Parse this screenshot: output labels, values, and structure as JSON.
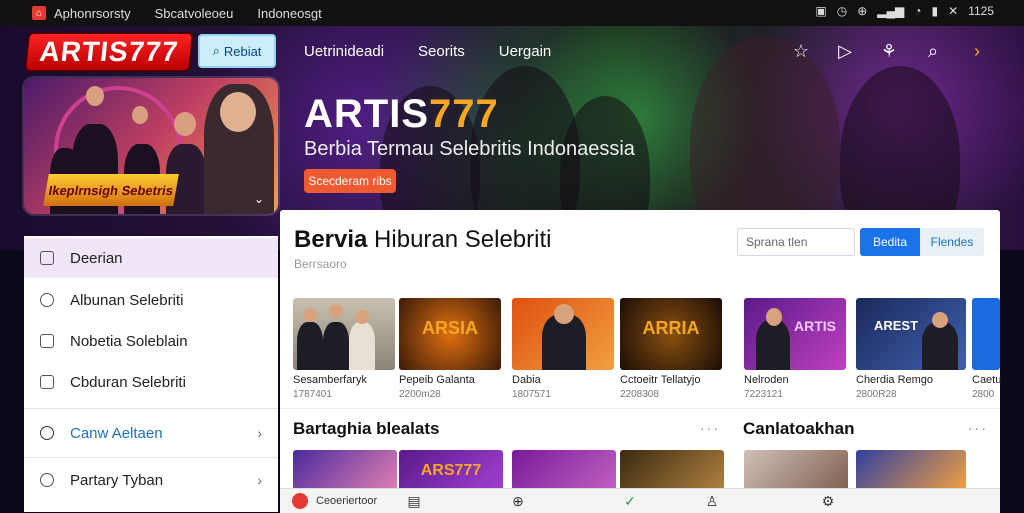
{
  "status_bar": {
    "items": [
      "Aphonrsorsty",
      "Sbcatvoleoeu",
      "Indoneosgt"
    ],
    "time": "1125"
  },
  "header": {
    "logo": "ARTIS777",
    "search_label": "Rebiat",
    "nav": [
      "Uetrinideadi",
      "Seorits",
      "Uergain"
    ]
  },
  "hero": {
    "badge": "Ikeplrnsigh Sebetris",
    "title_a": "ARTIS",
    "title_b": "777",
    "subtitle": "Berbia Termau Selebritis Indonaessia",
    "cta": "Scecderam ribs"
  },
  "sidebar": {
    "items": [
      {
        "label": "Deerian",
        "icon": "home-icon"
      },
      {
        "label": "Albunan Selebriti",
        "icon": "heart-icon"
      },
      {
        "label": "Nobetia Soleblain",
        "icon": "house-icon"
      },
      {
        "label": "Cbduran Selebriti",
        "icon": "square-icon"
      },
      {
        "label": "Canw Aeltaen",
        "icon": "heart-icon"
      },
      {
        "label": "Partary Tyban",
        "icon": "smile-icon"
      }
    ]
  },
  "main": {
    "title_bold": "Bervia",
    "title_rest": " Hiburan Selebriti",
    "subtitle": "Berrsaoro",
    "filter_placeholder": "Sprana tlen",
    "filter_btn_a": "Bedita",
    "filter_btn_b": "Flendes",
    "cards": [
      {
        "title": "Sesamberfaryk",
        "meta": "1787401",
        "thumb_text": ""
      },
      {
        "title": "Pepeib Galanta",
        "meta": "2200m28",
        "thumb_text": "ARSIA"
      },
      {
        "title": "Dabia",
        "meta": "1807571",
        "thumb_text": ""
      },
      {
        "title": "Cctoeitr Tellatyjo",
        "meta": "2208308",
        "thumb_text": "ARRIA"
      },
      {
        "title": "Nelroden",
        "meta": "7223121",
        "thumb_text": "ARTIS"
      },
      {
        "title": "Cherdia Remgo",
        "meta": "2800R28",
        "thumb_text": "AREST"
      },
      {
        "title": "Caetu",
        "meta": "2800",
        "thumb_text": ""
      }
    ],
    "section_left": "Bartaghia blealats",
    "section_right": "Canlatoakhan",
    "more": "···",
    "row2_texts": [
      "",
      "ARS777",
      "",
      "",
      "",
      ""
    ]
  },
  "bottom_bar": {
    "label": "Ceoeriertoor"
  }
}
